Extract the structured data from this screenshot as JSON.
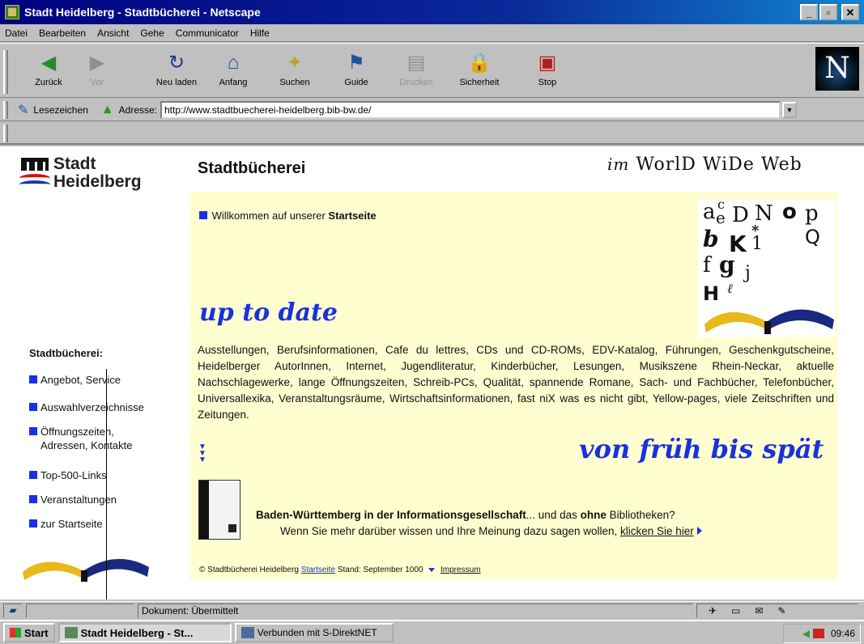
{
  "window": {
    "title": "Stadt Heidelberg - Stadtbücherei - Netscape",
    "min": "_",
    "max": "▫",
    "close": "✕"
  },
  "menu": [
    "Datei",
    "Bearbeiten",
    "Ansicht",
    "Gehe",
    "Communicator",
    "Hilfe"
  ],
  "toolbar": {
    "buttons": [
      {
        "label": "Zurück",
        "icon": "back-icon",
        "glyph": "◀",
        "color": "#2a8a2a"
      },
      {
        "label": "Vor",
        "icon": "forward-icon",
        "glyph": "▶",
        "color": "#7aa07a",
        "disabled": true
      },
      {
        "label": "Neu laden",
        "icon": "reload-icon",
        "glyph": "↻",
        "color": "#203880"
      },
      {
        "label": "Anfang",
        "icon": "home-icon",
        "glyph": "⌂",
        "color": "#2050a0"
      },
      {
        "label": "Suchen",
        "icon": "search-icon",
        "glyph": "✦",
        "color": "#c0a030"
      },
      {
        "label": "Guide",
        "icon": "guide-icon",
        "glyph": "⚑",
        "color": "#2050a0"
      },
      {
        "label": "Drucken",
        "icon": "print-icon",
        "glyph": "▤",
        "color": "#909090",
        "disabled": true
      },
      {
        "label": "Sicherheit",
        "icon": "lock-icon",
        "glyph": "🔒",
        "color": "#806030"
      },
      {
        "label": "Stop",
        "icon": "stop-icon",
        "glyph": "▣",
        "color": "#b02020"
      }
    ],
    "logo": "N"
  },
  "location": {
    "bookmarks": "Lesezeichen",
    "address_label": "Adresse:",
    "url": "http://www.stadtbuecherei-heidelberg.bib-bw.de/"
  },
  "page": {
    "logo_line1": "Stadt",
    "logo_line2": "Heidelberg",
    "header_title": "Stadtbücherei",
    "header_www_prefix": "im",
    "header_www": "WorlD WiDe Web",
    "welcome_pre": "Willkommen auf unserer ",
    "welcome_bold": "Startseite",
    "up_to_date": "up to date",
    "description": "Ausstellungen, Berufsinformationen, Cafe du lettres, CDs und CD-ROMs, EDV-Katalog, Führungen, Geschenkgutscheine, Heidelberger AutorInnen, Internet, Jugendliteratur, Kinderbücher, Lesungen, Musikszene Rhein-Neckar, aktuelle Nachschlagewerke, lange Öffnungszeiten, Schreib-PCs, Qualität, spannende Romane, Sach- und Fachbücher, Telefonbücher, Universallexika, Veranstaltungsräume, Wirtschaftsinformationen, fast niX was es nicht gibt, Yellow-pages, viele Zeitschriften und Zeitungen.",
    "von_frueh": "von früh bis spät",
    "bw_bold": "Baden-Württemberg in der Informationsgesellschaft",
    "bw_rest1": "... und das ",
    "bw_ohne": "ohne",
    "bw_rest2": " Bibliotheken?",
    "bw_line2": "Wenn Sie mehr darüber wissen und Ihre Meinung dazu sagen wollen, ",
    "bw_link": "klicken Sie hier",
    "footer_copy": "© Stadtbücherei Heidelberg",
    "footer_start": "Startseite",
    "footer_stand": "Stand: September 1000",
    "footer_impressum": "Impressum"
  },
  "sidebar": {
    "title": "Stadtbücherei:",
    "items": [
      {
        "label": "Angebot, Service"
      },
      {
        "label": "Auswahlverzeichnisse"
      },
      {
        "label": "Öffnungszeiten,",
        "label2": "Adressen, Kontakte"
      },
      {
        "label": "Top-500-Links"
      },
      {
        "label": "Veranstaltungen"
      },
      {
        "label": "zur Startseite"
      }
    ]
  },
  "status": {
    "text": "Dokument: Übermittelt",
    "components": "✈▭✉✎"
  },
  "taskbar": {
    "start": "Start",
    "active_task": "Stadt Heidelberg - St...",
    "other_task": "Verbunden mit S-DirektNET",
    "clock": "09:46"
  },
  "colors": {
    "accent_blue": "#1a30e0",
    "page_yellow": "#fefed0",
    "title_bar": "#000080"
  }
}
